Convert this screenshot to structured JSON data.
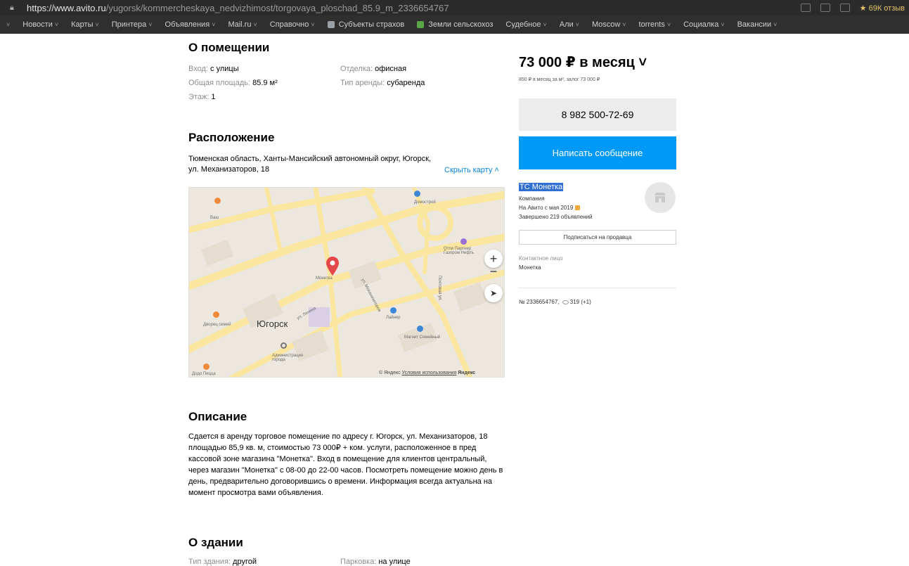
{
  "browser": {
    "url_host": "https://www.avito.ru",
    "url_path": "/yugorsk/kommercheskaya_nedvizhimost/torgovaya_ploschad_85.9_m_2336654767",
    "reviews": "★ 69К отзыв"
  },
  "bookmarks": [
    {
      "label": "Новости",
      "chevron": true
    },
    {
      "label": "Карты",
      "chevron": true
    },
    {
      "label": "Принтера",
      "chevron": true
    },
    {
      "label": "Объявления",
      "chevron": true
    },
    {
      "label": "Mail.ru",
      "chevron": true
    },
    {
      "label": "Справочно",
      "chevron": true
    },
    {
      "label": "Субъекты страхов",
      "chevron": false,
      "favicon": "#9aa1a8"
    },
    {
      "label": "Земли сельскохоз",
      "chevron": false,
      "favicon": "#5aa545"
    },
    {
      "label": "Судебное",
      "chevron": true
    },
    {
      "label": "Али",
      "chevron": true
    },
    {
      "label": "Moscow",
      "chevron": true
    },
    {
      "label": "torrents",
      "chevron": true
    },
    {
      "label": "Социалка",
      "chevron": true
    },
    {
      "label": "Вакансии",
      "chevron": true
    }
  ],
  "premises": {
    "title": "О помещении",
    "entrance_label": "Вход:",
    "entrance_value": "с улицы",
    "area_label": "Общая площадь:",
    "area_value": "85.9 м²",
    "floor_label": "Этаж:",
    "floor_value": "1",
    "finish_label": "Отделка:",
    "finish_value": "офисная",
    "lease_label": "Тип аренды:",
    "lease_value": "субаренда"
  },
  "location": {
    "title": "Расположение",
    "address_line1": "Тюменская область, Ханты-Мансийский автономный округ, Югорск,",
    "address_line2": "ул. Механизаторов, 18",
    "hide_map": "Скрыть карту ˄"
  },
  "map": {
    "city": "Югорск",
    "labels": {
      "vash": "Ваш",
      "domostroy": "Домострой",
      "ot_magnit": "Отпи Партнер Газпром Нефть",
      "monetka": "Монетка",
      "laiter": "Лайнер",
      "magnit": "Магнит Семейный",
      "dvorets": "Дворец семей",
      "admin": "Администрация города",
      "dodo": "Додо Пицца",
      "mechanics_street": "ул. Механизаторов",
      "pochtovaya": "Почтовая ул.",
      "lenina": "ул. Ленина"
    },
    "footer_prefix": "© Яндекс",
    "footer_terms": "Условия использования",
    "footer_brand": "Яндекс",
    "zoom_in": "+",
    "zoom_out": "−"
  },
  "description": {
    "title": "Описание",
    "text": "Сдается в аренду торговое помещение по адресу г. Югорск, ул. Механизаторов, 18 площадью 85,9 кв. м, стоимостью 73 000₽ + ком. услуги, расположенное в пред кассовой зоне магазина \"Монетка\". Вход в помещение для клиентов центральный, через магазин \"Монетка\" с 08-00 до 22-00 часов. Посмотреть помещение можно день в день, предварительно договорившись о времени. Информация всегда актуальна на момент просмотра вами объявления."
  },
  "building": {
    "title": "О здании",
    "type_label": "Тип здания:",
    "type_value": "другой",
    "parking_label": "Парковка:",
    "parking_value": "на улице"
  },
  "sidebar": {
    "price": "73 000 ₽ в месяц ˅",
    "price_sub": "850 ₽ в месяц за м², залог 73 000 ₽",
    "phone": "8 982 500-72-69",
    "message": "Написать сообщение",
    "seller_name": "ТС Монетка",
    "seller_type": "Компания",
    "seller_since": "На Авито с мая 2019",
    "seller_done": "Завершено 219 объявлений",
    "subscribe": "Подписаться на продавца",
    "contact_label": "Контактное лицо",
    "contact_value": "Монетка",
    "ad_number": "№ 2336654767,",
    "views": "319 (+1)"
  },
  "colors": {
    "accent_blue": "#0099f7",
    "link_blue": "#0a86d8",
    "map_pin": "#e5464a",
    "map_road": "#fbe9a8"
  }
}
